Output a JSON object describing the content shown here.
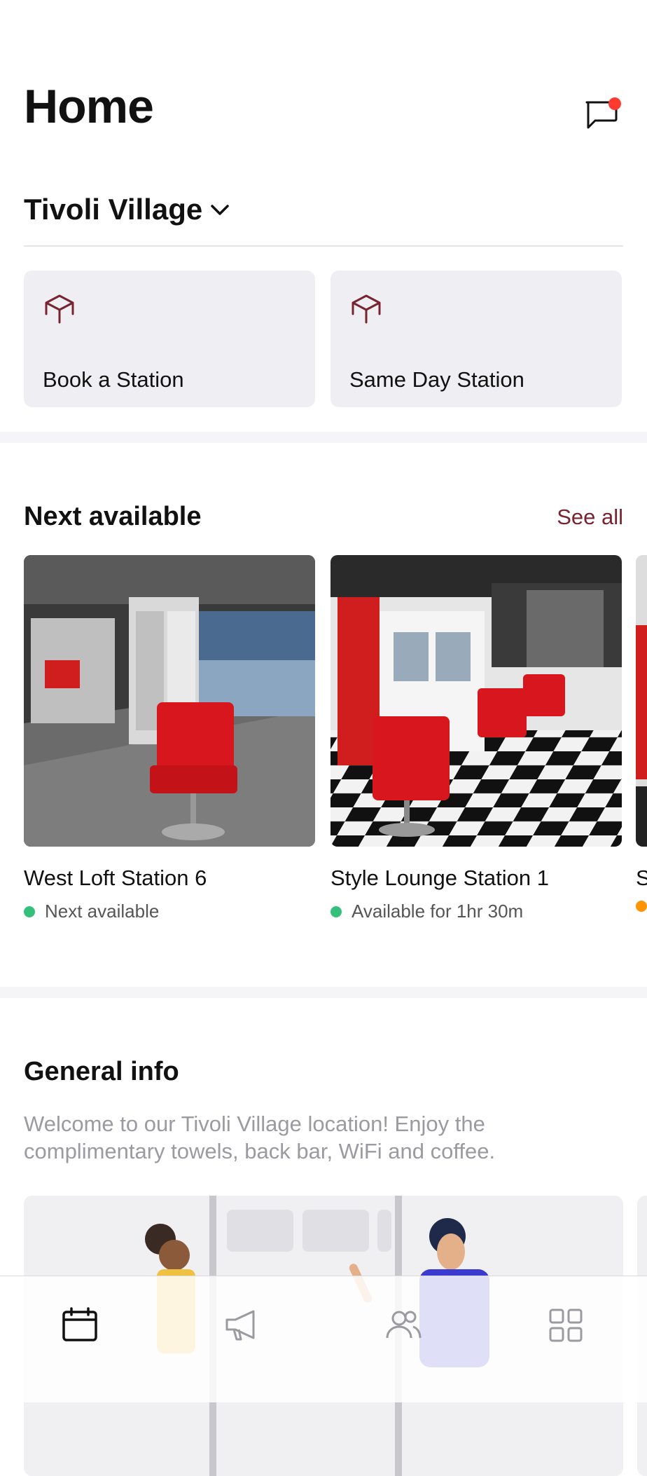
{
  "header": {
    "title": "Home",
    "messages_icon": "message-icon"
  },
  "location": {
    "name": "Tivoli Village",
    "dropdown_icon": "chevron-down-icon"
  },
  "actions": [
    {
      "label": "Book a Station",
      "icon": "cube-icon"
    },
    {
      "label": "Same Day Station",
      "icon": "cube-icon"
    }
  ],
  "next_available": {
    "heading": "Next available",
    "see_all": "See all",
    "cards": [
      {
        "name": "West Loft Station 6",
        "status": "Next available",
        "status_color": "#34c07a"
      },
      {
        "name": "Style Lounge Station 1",
        "status": "Available for 1hr 30m",
        "status_color": "#34c07a"
      },
      {
        "name": "S",
        "status": "",
        "status_color": "#ff9500"
      }
    ]
  },
  "general_info": {
    "heading": "General info",
    "text": "Welcome to our Tivoli Village location! Enjoy the complimentary towels, back bar, WiFi and coffee."
  },
  "tabbar": {
    "tabs": [
      {
        "icon": "calendar-icon",
        "active": true
      },
      {
        "icon": "megaphone-icon",
        "active": false
      },
      {
        "icon": "users-icon",
        "active": false
      },
      {
        "icon": "grid-icon",
        "active": false
      }
    ]
  },
  "colors": {
    "accent": "#7a2330",
    "notification": "#ff3b30",
    "card_bg": "#efeff3"
  }
}
